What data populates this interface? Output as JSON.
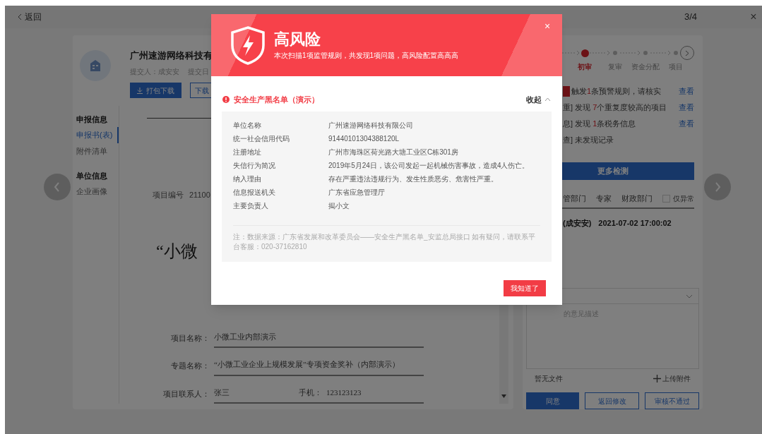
{
  "header": {
    "back": "返回",
    "counter": "3/4",
    "close": "×"
  },
  "applicant": {
    "company": "广州速游网络科技有",
    "submitter": "提交人：成安安",
    "submit_date": "提交日",
    "buttons": [
      {
        "label": "打包下载",
        "kind": "primary"
      },
      {
        "label": "下载",
        "kind": "outline"
      }
    ]
  },
  "nav": [
    {
      "heading": "申报信息",
      "items": [
        {
          "label": "申报书(表)",
          "selected": true
        },
        {
          "label": "附件清单",
          "selected": false
        }
      ]
    },
    {
      "heading": "单位信息",
      "items": [
        {
          "label": "企业画像",
          "selected": false
        }
      ]
    }
  ],
  "document": {
    "number_label": "项目编号",
    "number": "21100",
    "title": "“小微",
    "fields": [
      {
        "label": "项目名称：",
        "value": "小微工业内部演示"
      },
      {
        "label": "专题名称：",
        "value": "“小微工业企业上规模发展”专项资金奖补（内部演示）"
      },
      {
        "label": "项目联系人：",
        "value": "张三",
        "extra_label": "手机：",
        "extra_value": "123123123"
      }
    ]
  },
  "review": {
    "steps": [
      {
        "label": "初审",
        "current": true
      },
      {
        "label": "复审",
        "current": false
      },
      {
        "label": "资金分配",
        "current": false
      },
      {
        "label": "项目",
        "current": false
      }
    ],
    "checks": [
      {
        "tag": true,
        "before": "触发",
        "count": "1",
        "after": "条预警规则，请核实",
        "link": "查看"
      },
      {
        "tag": false,
        "before": "重] 发现 ",
        "count": "7",
        "after": "个重复度较高的项目",
        "link": "查看"
      },
      {
        "tag": false,
        "before": "息] 发现 ",
        "count": "1",
        "after": "条税务信息",
        "link": "查看"
      },
      {
        "tag": false,
        "before": "查] 未发现记录"
      }
    ],
    "more_button": "更多检测",
    "tabs": [
      "管部门",
      "专家",
      "财政部门"
    ],
    "abnormal_only": {
      "label": "仅异常",
      "checked": false
    },
    "record": {
      "who": "(成安安)",
      "time": "2021-07-02 17:00:02"
    },
    "opinion": {
      "placeholder": "的意见描述"
    },
    "files": "暂无文件",
    "upload": "上传附件",
    "actions": [
      {
        "label": "同意",
        "kind": "primary"
      },
      {
        "label": "返回修改",
        "kind": "outline"
      },
      {
        "label": "审核不通过",
        "kind": "outline"
      }
    ]
  },
  "modal": {
    "title": "高风险",
    "subtitle": "本次扫描1项监管规则，共发现1项问题，高风险配置高高高",
    "close": "×",
    "section": {
      "title": "安全生产黑名单（演示）",
      "toggle": "收起",
      "expanded": true
    },
    "rows": [
      {
        "label": "单位名称",
        "value": "广州速游网络科技有限公司"
      },
      {
        "label": "统一社会信用代码",
        "value": "91440101304388120L"
      },
      {
        "label": "注册地址",
        "value": "广州市海珠区荷光路大塘工业区C栋301房"
      },
      {
        "label": "失信行为简况",
        "value": "2019年5月24日，该公司发起一起机械伤害事故，造成4人伤亡。"
      },
      {
        "label": "纳入理由",
        "value": "存在严重违法违规行为、发生性质恶劣、危害性严重。"
      },
      {
        "label": "信息报送机关",
        "value": "广东省应急管理厅"
      },
      {
        "label": "主要负责人",
        "value": "揭小文"
      }
    ],
    "note": "注：数据来源：广东省发展和改革委员会——安全生产黑名单_安监总局接口 如有疑问，请联系平台客服：020-37162810",
    "button": "我知道了"
  }
}
